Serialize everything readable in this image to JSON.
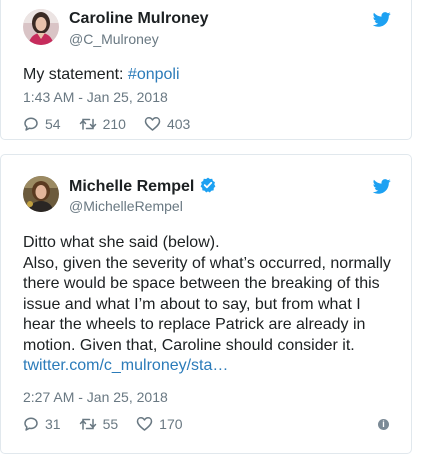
{
  "colors": {
    "text": "#1c2022",
    "secondary": "#697882",
    "link": "#2b7bb9",
    "twitter_blue": "#1da1f2",
    "border": "#e1e8ed"
  },
  "tweets": [
    {
      "author": {
        "name": "Caroline Mulroney",
        "handle": "@C_Mulroney",
        "avatar_icon": "profile-photo"
      },
      "text_prefix": "My statement: ",
      "hashtag": "#onpoli",
      "timestamp": "1:43 AM - Jan 25, 2018",
      "actions": {
        "replies": "54",
        "retweets": "210",
        "likes": "403"
      },
      "icons": [
        "twitter-bird-icon",
        "reply-icon",
        "retweet-icon",
        "heart-icon"
      ]
    },
    {
      "author": {
        "name": "Michelle Rempel",
        "handle": "@MichelleRempel",
        "verified": true,
        "avatar_icon": "profile-photo"
      },
      "lines": [
        "Ditto what she said (below).",
        "Also, given the severity of what’s occurred, normally",
        "there would be space between the breaking of this",
        "issue and what I’m about to say, but from what I",
        "hear the wheels to replace Patrick are already in",
        "motion. Given that, Caroline should consider it."
      ],
      "link": "twitter.com/c_mulroney/sta…",
      "timestamp": "2:27 AM - Jan 25, 2018",
      "actions": {
        "replies": "31",
        "retweets": "55",
        "likes": "170"
      },
      "icons": [
        "twitter-bird-icon",
        "verified-badge-icon",
        "reply-icon",
        "retweet-icon",
        "heart-icon",
        "info-icon"
      ]
    }
  ]
}
